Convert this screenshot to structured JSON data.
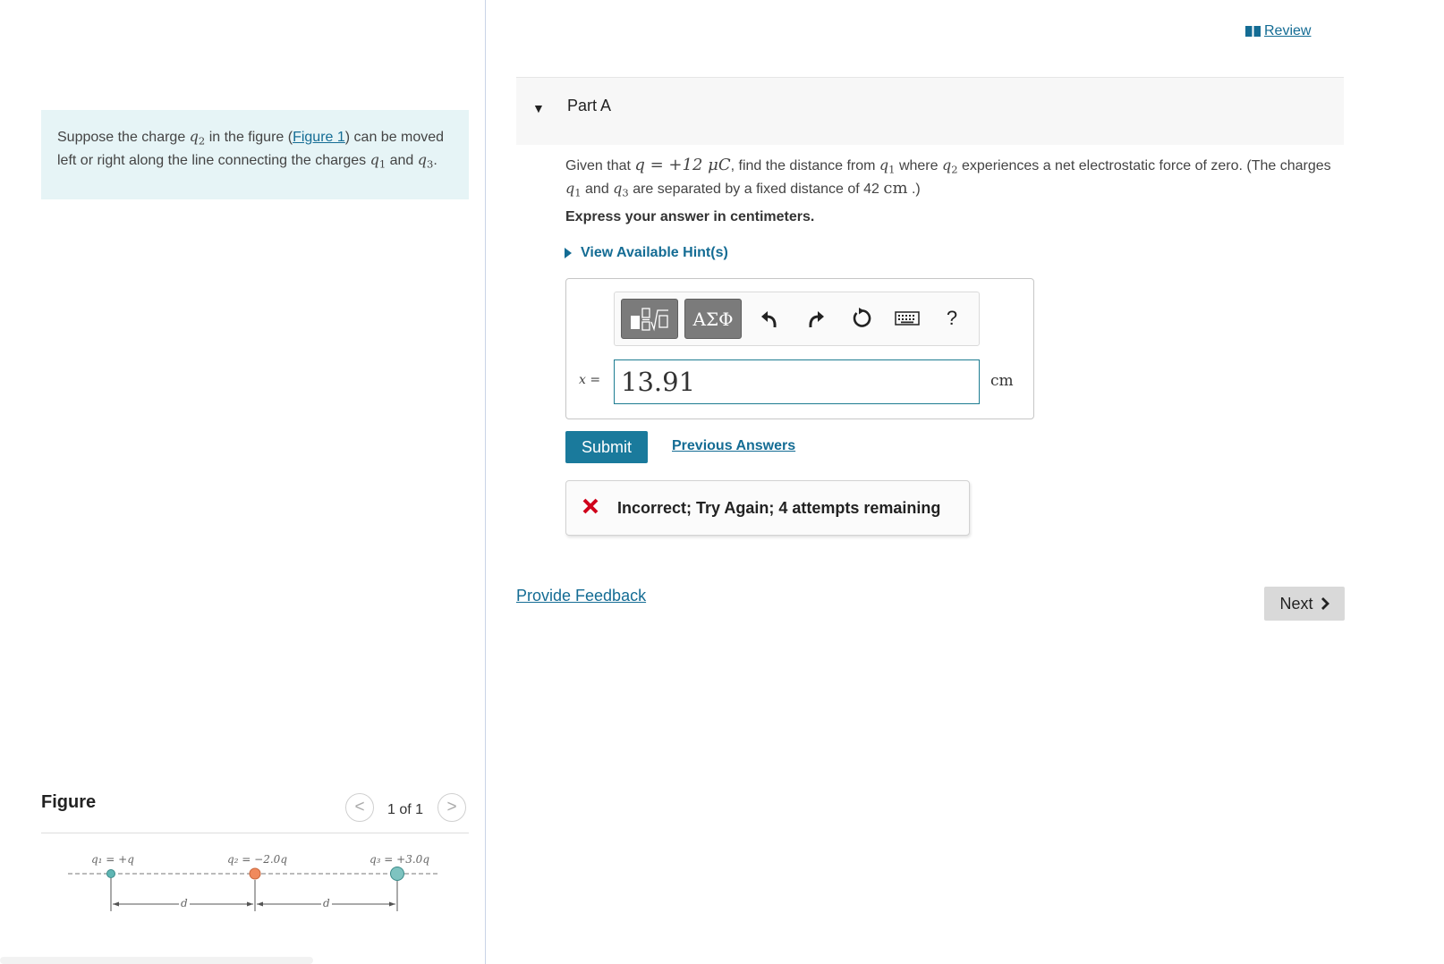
{
  "intro": {
    "text_1": "Suppose the charge ",
    "q2_var": "q",
    "q2_sub": "2",
    "text_2": " in the figure (",
    "figure_link": "Figure 1",
    "text_3": ") can be moved left or right along the line connecting the charges ",
    "q1_var": "q",
    "q1_sub": "1",
    "text_4": " and ",
    "q3_var": "q",
    "q3_sub": "3",
    "text_5": "."
  },
  "figure_panel": {
    "heading": "Figure",
    "counter": "1 of 1",
    "prev_glyph": "<",
    "next_glyph": ">",
    "diagram": {
      "q1_label": "q₁ = +q",
      "q2_label": "q₂ = −2.0q",
      "q3_label": "q₃ = +3.0q",
      "d_label_1": "d",
      "d_label_2": "d",
      "colors": {
        "q1": "#5fb6b4",
        "q2": "#f08a5d",
        "q3": "#7ec3c0"
      }
    }
  },
  "header": {
    "review_label": "Review",
    "review_icon": "book-icon"
  },
  "part": {
    "caret": "▼",
    "title": "Part A"
  },
  "question": {
    "t1": "Given that ",
    "eq": "q = +12 μC",
    "t2": ", find the distance from ",
    "q1_var": "q",
    "q1_sub": "1",
    "t3": " where ",
    "q2_var": "q",
    "q2_sub": "2",
    "t4": " experiences a net electrostatic force of zero. (The charges ",
    "q1b_var": "q",
    "q1b_sub": "1",
    "t5": " and ",
    "q3_var": "q",
    "q3_sub": "3",
    "t6": " are separated by a fixed distance of 42 ",
    "unit": "cm",
    "t7": " .)"
  },
  "instruction": "Express your answer in centimeters.",
  "hints_label": "View Available Hint(s)",
  "answer": {
    "toolbar": {
      "templates_icon": "templates-icon",
      "symbols_label": "ΑΣΦ",
      "undo_icon": "undo-icon",
      "redo_icon": "redo-icon",
      "reset_icon": "reset-icon",
      "keyboard_icon": "keyboard-icon",
      "help_label": "?"
    },
    "variable_label": "x =",
    "value": "13.91",
    "unit": "cm"
  },
  "actions": {
    "submit_label": "Submit",
    "previous_answers_label": "Previous Answers"
  },
  "feedback": {
    "icon": "x-icon",
    "color": "#d0021b",
    "message": "Incorrect; Try Again; 4 attempts remaining"
  },
  "footer": {
    "provide_feedback_label": "Provide Feedback",
    "next_label": "Next"
  }
}
